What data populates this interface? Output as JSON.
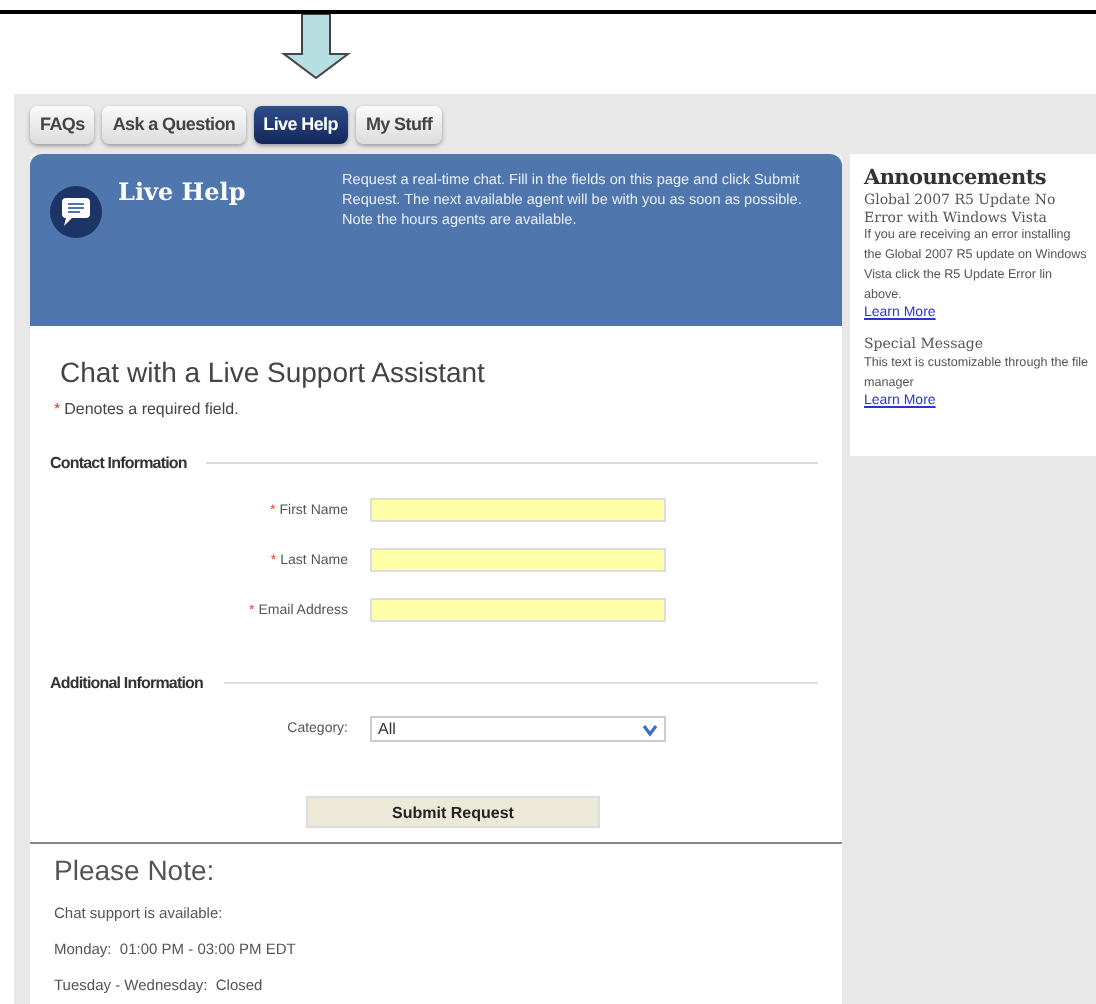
{
  "tabs": [
    {
      "label": "FAQs",
      "selected": false
    },
    {
      "label": "Ask a Question",
      "selected": false
    },
    {
      "label": "Live Help",
      "selected": true
    },
    {
      "label": "My Stuff",
      "selected": false
    }
  ],
  "banner": {
    "title": "Live Help",
    "description": "Request a real-time chat. Fill in the fields on this page and click Submit Request. The next available agent will be with you as soon as possible. Note the hours agents are available."
  },
  "form": {
    "title": "Chat with a Live Support Assistant",
    "required_note": {
      "mark": "*",
      "text": "Denotes a required field."
    },
    "sections": [
      {
        "title": "Contact Information",
        "fields": [
          {
            "kind": "text",
            "mark": "*",
            "label": "First Name"
          },
          {
            "kind": "text",
            "mark": "*",
            "label": "Last Name"
          },
          {
            "kind": "text",
            "mark": "*",
            "label": "Email Address"
          }
        ]
      },
      {
        "title": "Additional Information",
        "fields": [
          {
            "kind": "select",
            "label": "Category:",
            "value": "All"
          }
        ]
      }
    ],
    "submit": "Submit Request"
  },
  "note": {
    "title": "Please Note:",
    "lines": [
      "Chat support is available:",
      "Monday:  01:00 PM - 03:00 PM EDT",
      "Tuesday - Wednesday:  Closed"
    ]
  },
  "sidebar": {
    "title": "Announcements",
    "items": [
      {
        "heading": "Global 2007 R5 Update No Error with Windows Vista",
        "body": "If you are receiving an error installing the Global 2007 R5 update on Windows Vista click the R5 Update Error lin above.",
        "link": "Learn More"
      },
      {
        "heading": "Special Message",
        "body": "This text is customizable through the file manager",
        "link": "Learn More"
      }
    ]
  }
}
